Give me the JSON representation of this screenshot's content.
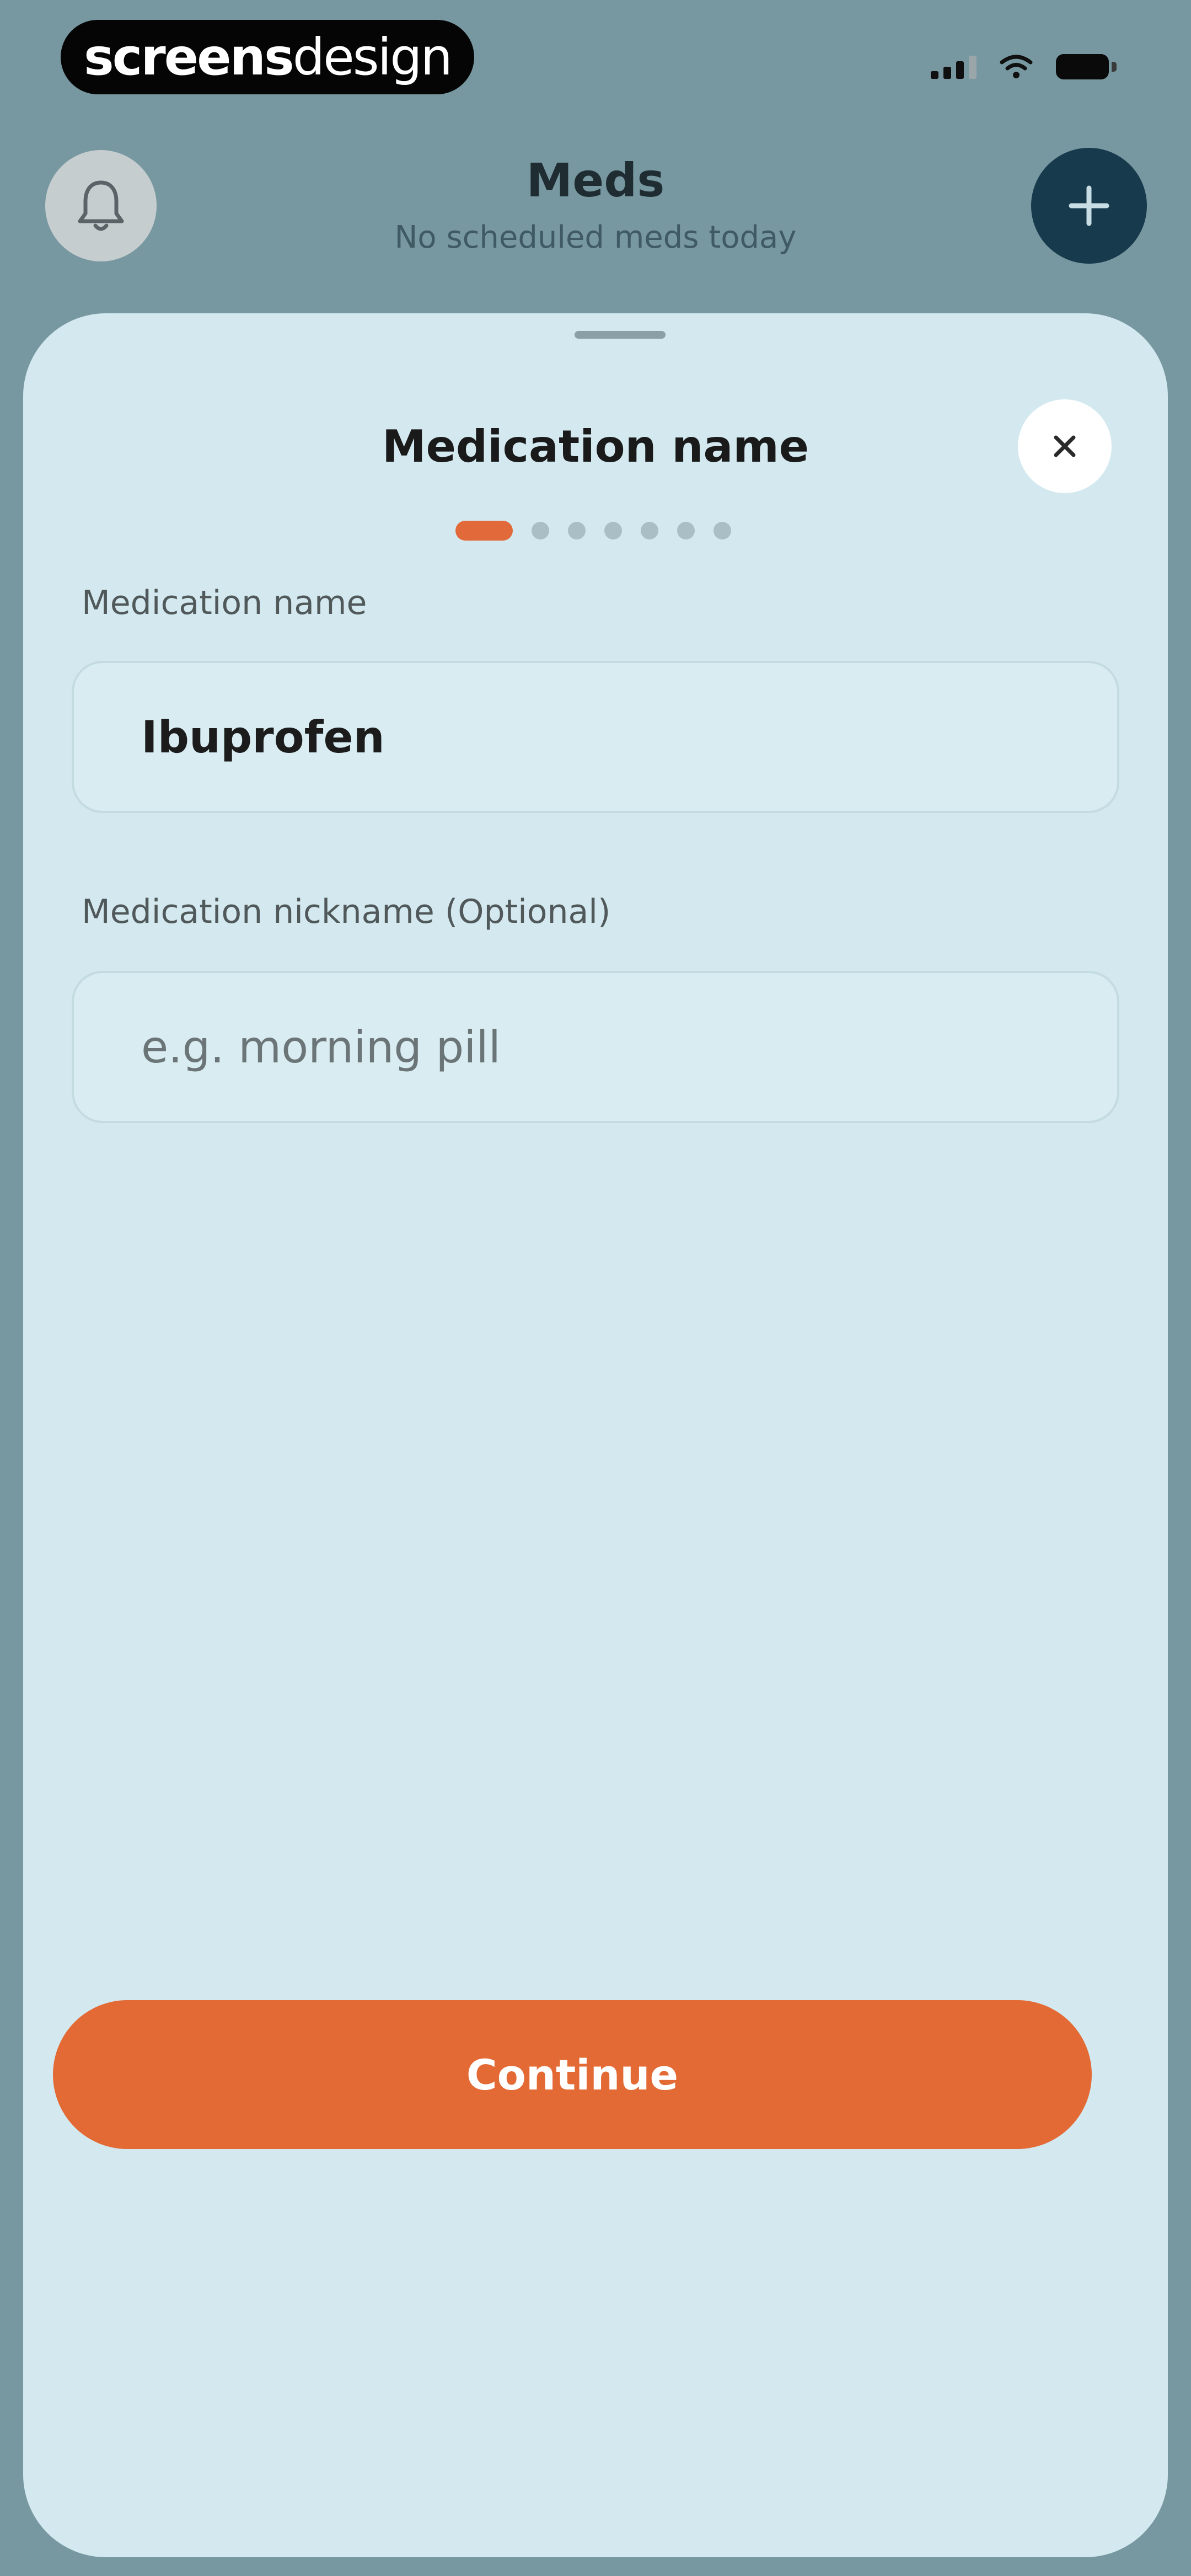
{
  "status_bar": {
    "brand_bold": "screens",
    "brand_light": "design",
    "icons": [
      "cellular-signal-icon",
      "wifi-icon",
      "battery-icon"
    ]
  },
  "header": {
    "title": "Meds",
    "subtitle": "No scheduled meds today",
    "left_icon": "bell-icon",
    "right_icon": "plus-icon"
  },
  "sheet": {
    "title": "Medication name",
    "close_icon": "close-icon",
    "progress": {
      "current_step": 1,
      "total_steps": 7
    },
    "fields": {
      "name": {
        "label": "Medication name",
        "value": "Ibuprofen",
        "placeholder": ""
      },
      "nickname": {
        "label": "Medication nickname (Optional)",
        "value": "",
        "placeholder": "e.g. morning pill"
      }
    },
    "continue_label": "Continue"
  },
  "colors": {
    "accent": "#e36a35",
    "sheet_background": "#d3e9ef",
    "overlay_background": "#7898a1",
    "add_button": "#173a4d"
  }
}
